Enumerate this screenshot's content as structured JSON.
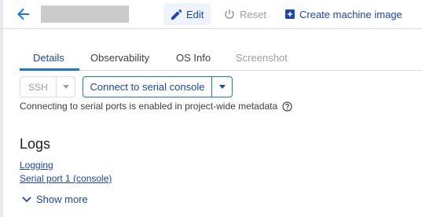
{
  "header": {
    "edit_label": "Edit",
    "reset_label": "Reset",
    "create_image_label": "Create machine image"
  },
  "tabs": [
    {
      "label": "Details",
      "state": "active"
    },
    {
      "label": "Observability",
      "state": "normal"
    },
    {
      "label": "OS Info",
      "state": "normal"
    },
    {
      "label": "Screenshot",
      "state": "disabled"
    }
  ],
  "ssh": {
    "label": "SSH"
  },
  "serial": {
    "label": "Connect to serial console"
  },
  "info_text": "Connecting to serial ports is enabled in project-wide metadata",
  "logs": {
    "title": "Logs",
    "links": [
      "Logging",
      "Serial port 1 (console)"
    ],
    "show_more": "Show more"
  },
  "colors": {
    "accent": "#1a73e8",
    "link": "#1a46b8",
    "disabled": "#9aa0a6"
  }
}
